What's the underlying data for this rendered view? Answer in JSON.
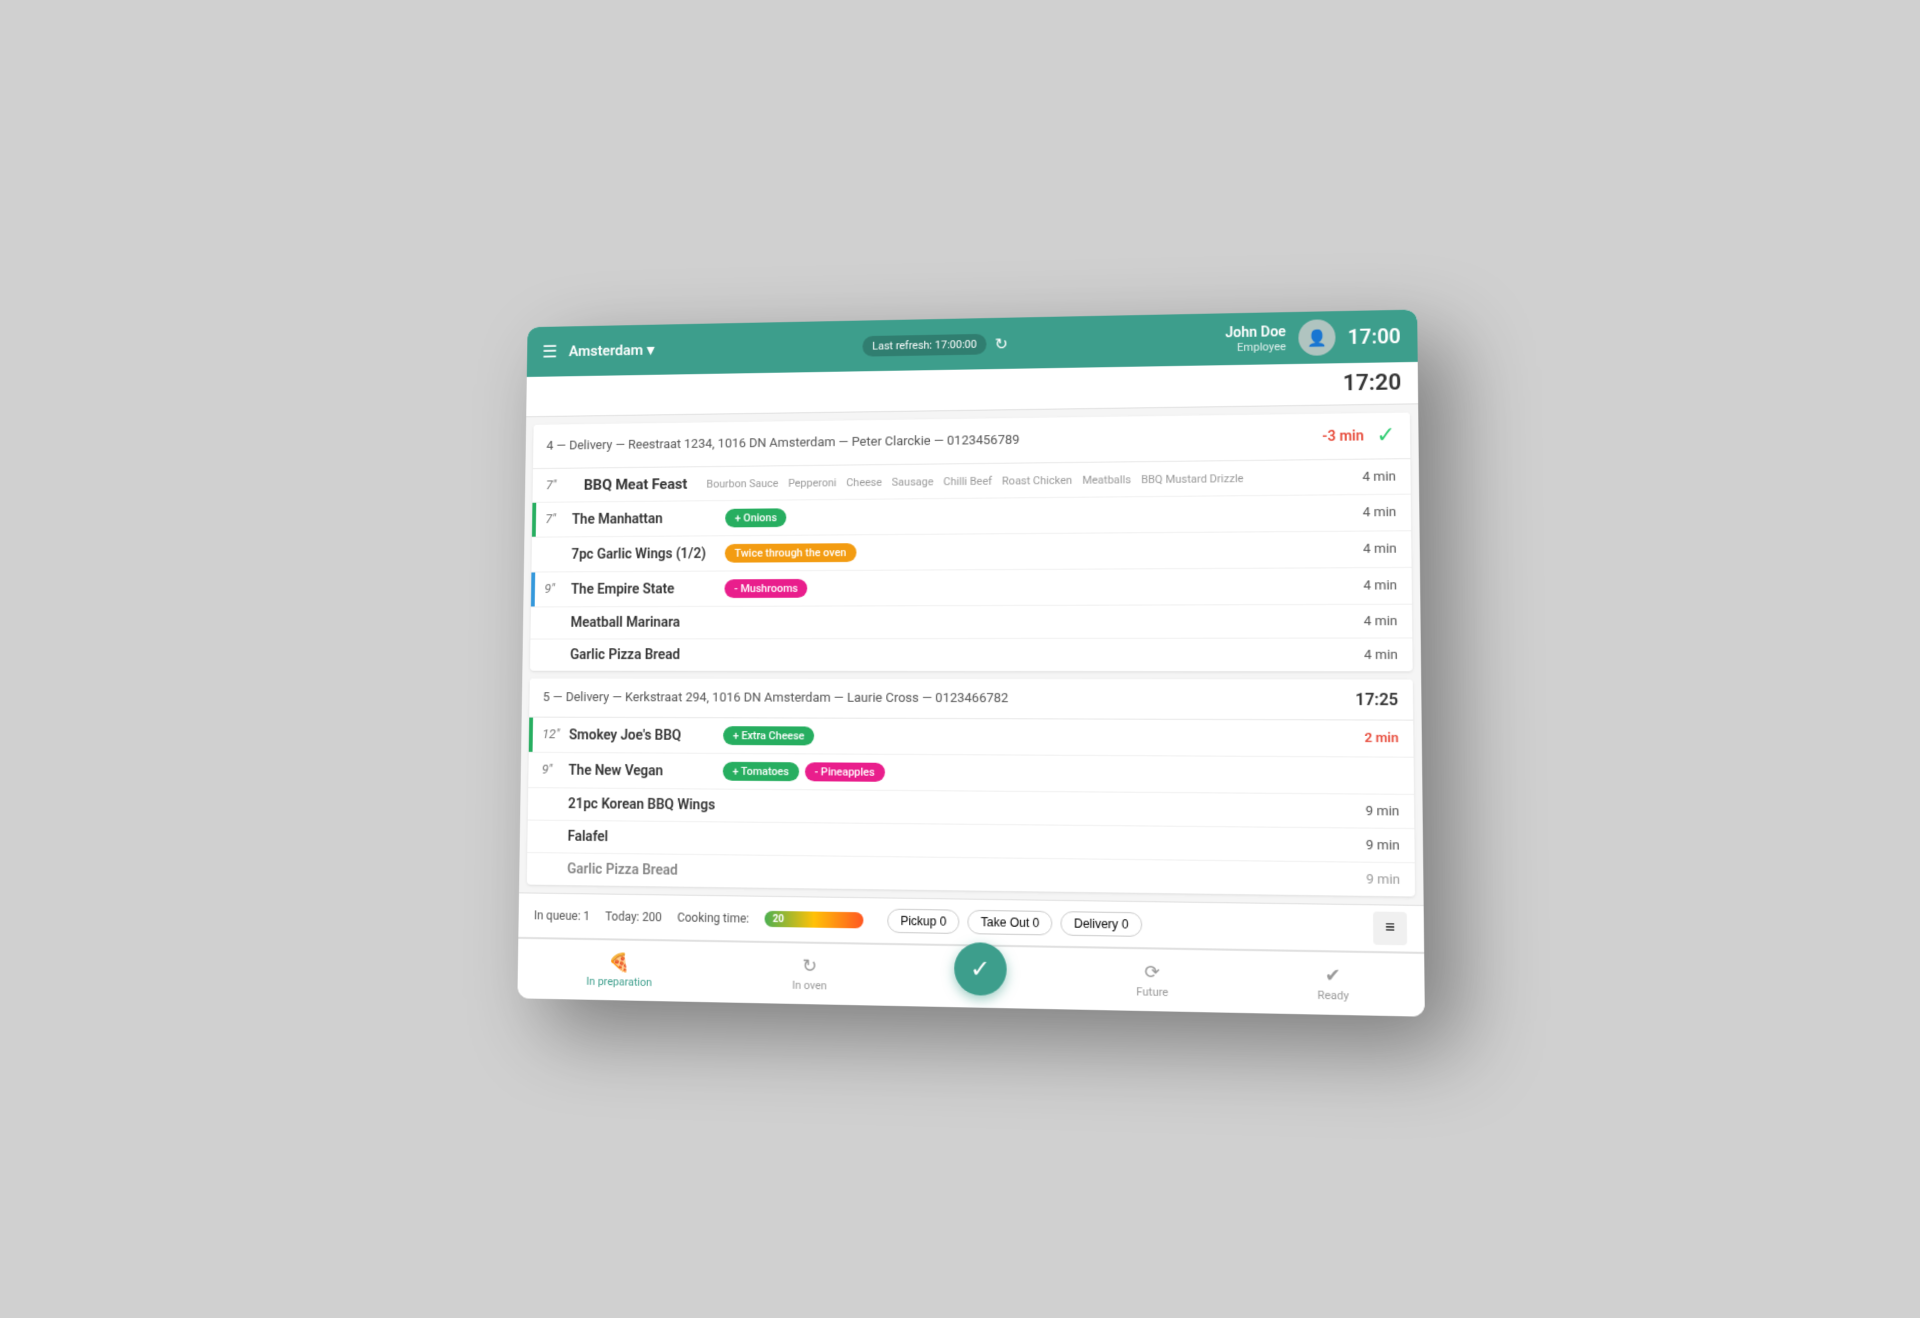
{
  "header": {
    "hamburger": "☰",
    "location": "Amsterdam",
    "location_arrow": "▾",
    "refresh_label": "Last refresh: 17:00:00",
    "time": "17:00",
    "user_name": "John Doe",
    "user_role": "Employee"
  },
  "toolbar": {
    "current_time": "17:20"
  },
  "orders": [
    {
      "id": "order-1",
      "info": "4 — Delivery — Reestraat 1234, 1016 DN Amsterdam — Peter Clarckie — 0123456789",
      "time_status": "-3 min",
      "time_status_type": "negative",
      "scheduled_time": "",
      "items": [
        {
          "type": "product-header",
          "size": "7\"",
          "name": "BBQ Meat Feast",
          "sub_items": [
            "Bourbon Sauce",
            "Pepperoni",
            "Cheese",
            "Sausage",
            "Chilli Beef",
            "Roast Chicken",
            "Meatballs",
            "BBQ Mustard Drizzle"
          ]
        },
        {
          "type": "product",
          "size": "7\"",
          "name": "The Manhattan",
          "modifiers": [
            {
              "label": "+ Onions",
              "type": "green"
            }
          ],
          "timer": "4 min",
          "accent": "green"
        },
        {
          "type": "product",
          "size": "",
          "name": "7pc Garlic Wings (1/2)",
          "modifiers": [
            {
              "label": "Twice through the oven",
              "type": "orange"
            }
          ],
          "timer": "4 min",
          "accent": ""
        },
        {
          "type": "product",
          "size": "9\"",
          "name": "The Empire State",
          "modifiers": [
            {
              "label": "- Mushrooms",
              "type": "pink"
            }
          ],
          "timer": "4 min",
          "accent": "blue"
        },
        {
          "type": "product",
          "size": "",
          "name": "Meatball Marinara",
          "modifiers": [],
          "timer": "4 min",
          "accent": ""
        },
        {
          "type": "product",
          "size": "",
          "name": "Garlic Pizza Bread",
          "modifiers": [],
          "timer": "4 min",
          "accent": ""
        }
      ]
    },
    {
      "id": "order-2",
      "info": "5 — Delivery — Kerkstraat 294, 1016 DN Amsterdam — Laurie Cross — 0123466782",
      "time_status": "2 min",
      "time_status_type": "warning",
      "scheduled_time": "17:25",
      "items": [
        {
          "type": "product",
          "size": "12\"",
          "name": "Smokey Joe's BBQ",
          "modifiers": [
            {
              "label": "+ Extra Cheese",
              "type": "green"
            }
          ],
          "timer": "",
          "accent": "green"
        },
        {
          "type": "product",
          "size": "9\"",
          "name": "The New Vegan",
          "modifiers": [
            {
              "label": "+ Tomatoes",
              "type": "green"
            },
            {
              "label": "- Pineapples",
              "type": "pink"
            }
          ],
          "timer": "",
          "accent": ""
        },
        {
          "type": "product",
          "size": "",
          "name": "21pc Korean BBQ Wings",
          "modifiers": [],
          "timer": "9 min",
          "accent": ""
        },
        {
          "type": "product",
          "size": "",
          "name": "Falafel",
          "modifiers": [],
          "timer": "9 min",
          "accent": ""
        },
        {
          "type": "product",
          "size": "",
          "name": "Garlic Pizza Bread",
          "modifiers": [],
          "timer": "9 min",
          "accent": ""
        }
      ]
    }
  ],
  "status_bar": {
    "in_queue_label": "In queue: 1",
    "today_label": "Today: 200",
    "cooking_time_label": "Cooking time:",
    "cooking_number": "20"
  },
  "bottom_nav": {
    "in_preparation": "In preparation",
    "in_oven": "In oven",
    "future": "Future",
    "ready": "Ready"
  },
  "order_types": {
    "pickup": "Pickup  0",
    "take_out": "Take Out  0",
    "delivery": "Delivery  0"
  }
}
